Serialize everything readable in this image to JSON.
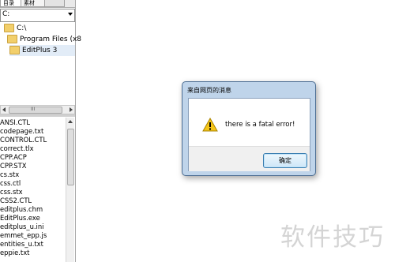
{
  "sidebar": {
    "tabs": [
      {
        "label": "目录"
      },
      {
        "label": "素材"
      },
      {
        "label": ""
      }
    ],
    "drive": {
      "value": "C:"
    },
    "tree": [
      {
        "label": "C:\\"
      },
      {
        "label": "Program Files (x8"
      },
      {
        "label": "EditPlus 3"
      }
    ],
    "hscroll_grip": "III",
    "files": [
      "ANSI.CTL",
      "codepage.txt",
      "CONTROL.CTL",
      "correct.tlx",
      "CPP.ACP",
      "CPP.STX",
      "cs.stx",
      "css.ctl",
      "css.stx",
      "CSS2.CTL",
      "editplus.chm",
      "EditPlus.exe",
      "editplus_u.ini",
      "emmet_epp.js",
      "entities_u.txt",
      "eppie.txt"
    ]
  },
  "dialog": {
    "title": "来自网页的消息",
    "message": "there is a fatal error!",
    "ok_label": "确定",
    "icon": "warning-icon"
  },
  "watermark": "软件技巧",
  "colors": {
    "selection": "#e2ecf7",
    "folder": "#f2cf6b",
    "dialog_frame": "#bfd4ea",
    "warning": "#f5c518"
  }
}
